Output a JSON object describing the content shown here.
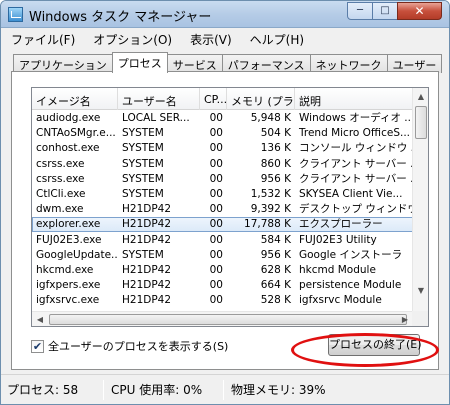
{
  "window": {
    "title": "Windows タスク マネージャー",
    "controls": {
      "minimize": "─",
      "maximize": "□",
      "close": "✕"
    }
  },
  "menu": [
    "ファイル(F)",
    "オプション(O)",
    "表示(V)",
    "ヘルプ(H)"
  ],
  "tabs": [
    {
      "label": "アプリケーション",
      "active": false
    },
    {
      "label": "プロセス",
      "active": true
    },
    {
      "label": "サービス",
      "active": false
    },
    {
      "label": "パフォーマンス",
      "active": false
    },
    {
      "label": "ネットワーク",
      "active": false
    },
    {
      "label": "ユーザー",
      "active": false
    }
  ],
  "columns": [
    "イメージ名",
    "ユーザー名",
    "CP...",
    "メモリ (プラ...",
    "説明"
  ],
  "rows": [
    {
      "image": "audiodg.exe",
      "user": "LOCAL SER...",
      "cpu": "00",
      "mem": "5,948 K",
      "desc": "Windows オーディオ ..."
    },
    {
      "image": "CNTAoSMgr.e...",
      "user": "SYSTEM",
      "cpu": "00",
      "mem": "504 K",
      "desc": "Trend Micro OfficeS..."
    },
    {
      "image": "conhost.exe",
      "user": "SYSTEM",
      "cpu": "00",
      "mem": "136 K",
      "desc": "コンソール ウィンドウ ..."
    },
    {
      "image": "csrss.exe",
      "user": "SYSTEM",
      "cpu": "00",
      "mem": "860 K",
      "desc": "クライアント サーバー ..."
    },
    {
      "image": "csrss.exe",
      "user": "SYSTEM",
      "cpu": "00",
      "mem": "956 K",
      "desc": "クライアント サーバー ..."
    },
    {
      "image": "CtlCli.exe",
      "user": "SYSTEM",
      "cpu": "00",
      "mem": "1,532 K",
      "desc": "SKYSEA Client Vie..."
    },
    {
      "image": "dwm.exe",
      "user": "H21DP42",
      "cpu": "00",
      "mem": "9,392 K",
      "desc": "デスクトップ ウィンドウ ..."
    },
    {
      "image": "explorer.exe",
      "user": "H21DP42",
      "cpu": "00",
      "mem": "17,788 K",
      "desc": "エクスプローラー",
      "selected": true
    },
    {
      "image": "FUJ02E3.exe",
      "user": "H21DP42",
      "cpu": "00",
      "mem": "584 K",
      "desc": "FUJ02E3 Utility"
    },
    {
      "image": "GoogleUpdate....",
      "user": "SYSTEM",
      "cpu": "00",
      "mem": "956 K",
      "desc": "Google インストーラ"
    },
    {
      "image": "hkcmd.exe",
      "user": "H21DP42",
      "cpu": "00",
      "mem": "628 K",
      "desc": "hkcmd Module"
    },
    {
      "image": "igfxpers.exe",
      "user": "H21DP42",
      "cpu": "00",
      "mem": "664 K",
      "desc": "persistence Module"
    },
    {
      "image": "igfxsrvc.exe",
      "user": "H21DP42",
      "cpu": "00",
      "mem": "528 K",
      "desc": "igfxsrvc Module"
    }
  ],
  "show_all_users": {
    "label": "全ユーザーのプロセスを表示する(S)",
    "checked": "✔"
  },
  "end_process_button": "プロセスの終了(E)",
  "status": {
    "processes": "プロセス: 58",
    "cpu": "CPU 使用率: 0%",
    "memory": "物理メモリ: 39%"
  },
  "colors": {
    "title_bar": "#b4cbe6",
    "close_button": "#c7503c",
    "highlight_oval": "#e01010",
    "selection": "#7da2ce"
  }
}
